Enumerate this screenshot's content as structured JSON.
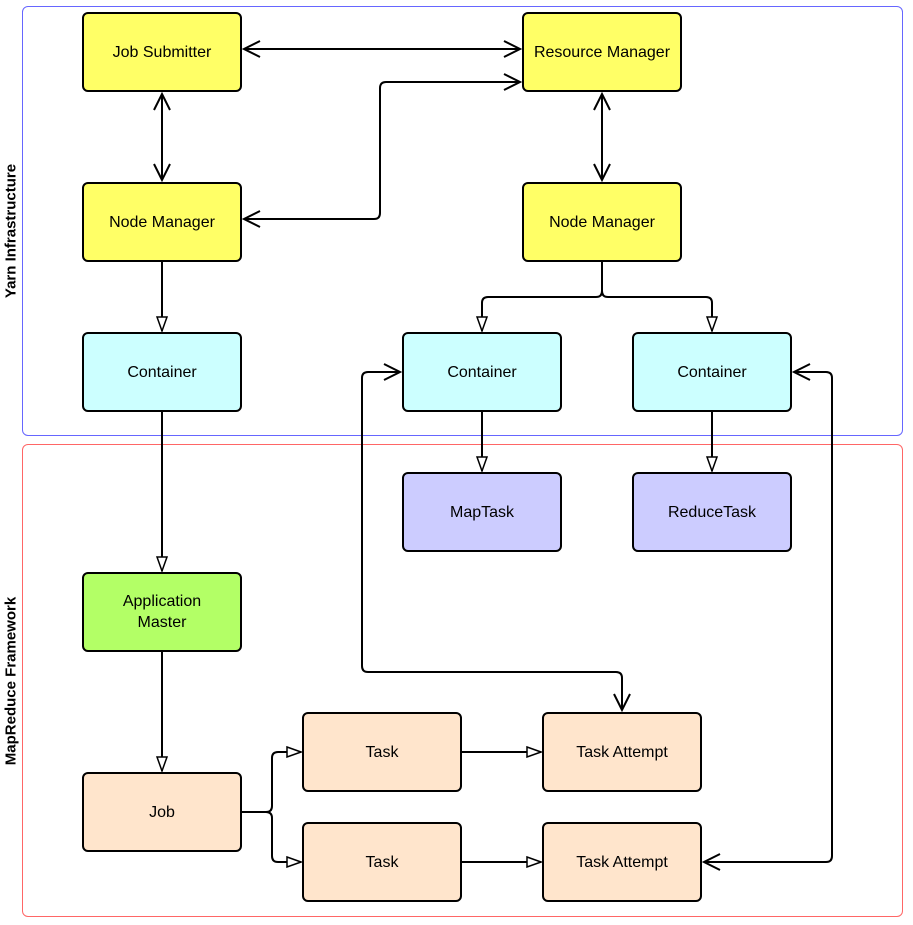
{
  "colors": {
    "yarn_frame": "#6666ff",
    "mapreduce_frame": "#ff6666",
    "yellow": "#ffff66",
    "cyan": "#ccffff",
    "lavender": "#ccccff",
    "green": "#b3ff66",
    "peach": "#ffe5cc"
  },
  "groups": {
    "yarn": "Yarn Infrastructure",
    "mapreduce": "MapReduce Framework"
  },
  "nodes": {
    "job_submitter": "Job Submitter",
    "resource_manager": "Resource Manager",
    "node_manager_left": "Node Manager",
    "node_manager_right": "Node Manager",
    "container_left": "Container",
    "container_middle": "Container",
    "container_right": "Container",
    "map_task": "MapTask",
    "reduce_task": "ReduceTask",
    "application_master": "Application Master",
    "job": "Job",
    "task_1": "Task",
    "task_2": "Task",
    "task_attempt_1": "Task Attempt",
    "task_attempt_2": "Task Attempt"
  },
  "edges": [
    {
      "from": "job_submitter",
      "to": "resource_manager",
      "type": "bidirectional"
    },
    {
      "from": "node_manager_left",
      "to": "resource_manager",
      "type": "bidirectional"
    },
    {
      "from": "job_submitter",
      "to": "node_manager_left",
      "type": "bidirectional"
    },
    {
      "from": "resource_manager",
      "to": "node_manager_right",
      "type": "bidirectional"
    },
    {
      "from": "node_manager_left",
      "to": "container_left",
      "type": "directed"
    },
    {
      "from": "node_manager_right",
      "to": "container_middle",
      "type": "directed"
    },
    {
      "from": "node_manager_right",
      "to": "container_right",
      "type": "directed"
    },
    {
      "from": "container_left",
      "to": "application_master",
      "type": "directed"
    },
    {
      "from": "container_middle",
      "to": "map_task",
      "type": "directed"
    },
    {
      "from": "container_right",
      "to": "reduce_task",
      "type": "directed"
    },
    {
      "from": "application_master",
      "to": "job",
      "type": "directed"
    },
    {
      "from": "job",
      "to": "task_1",
      "type": "directed"
    },
    {
      "from": "job",
      "to": "task_2",
      "type": "directed"
    },
    {
      "from": "task_1",
      "to": "task_attempt_1",
      "type": "directed"
    },
    {
      "from": "task_2",
      "to": "task_attempt_2",
      "type": "directed"
    },
    {
      "from": "container_middle",
      "to": "task_attempt_1",
      "type": "bidirectional"
    },
    {
      "from": "container_right",
      "to": "task_attempt_2",
      "type": "bidirectional"
    }
  ]
}
